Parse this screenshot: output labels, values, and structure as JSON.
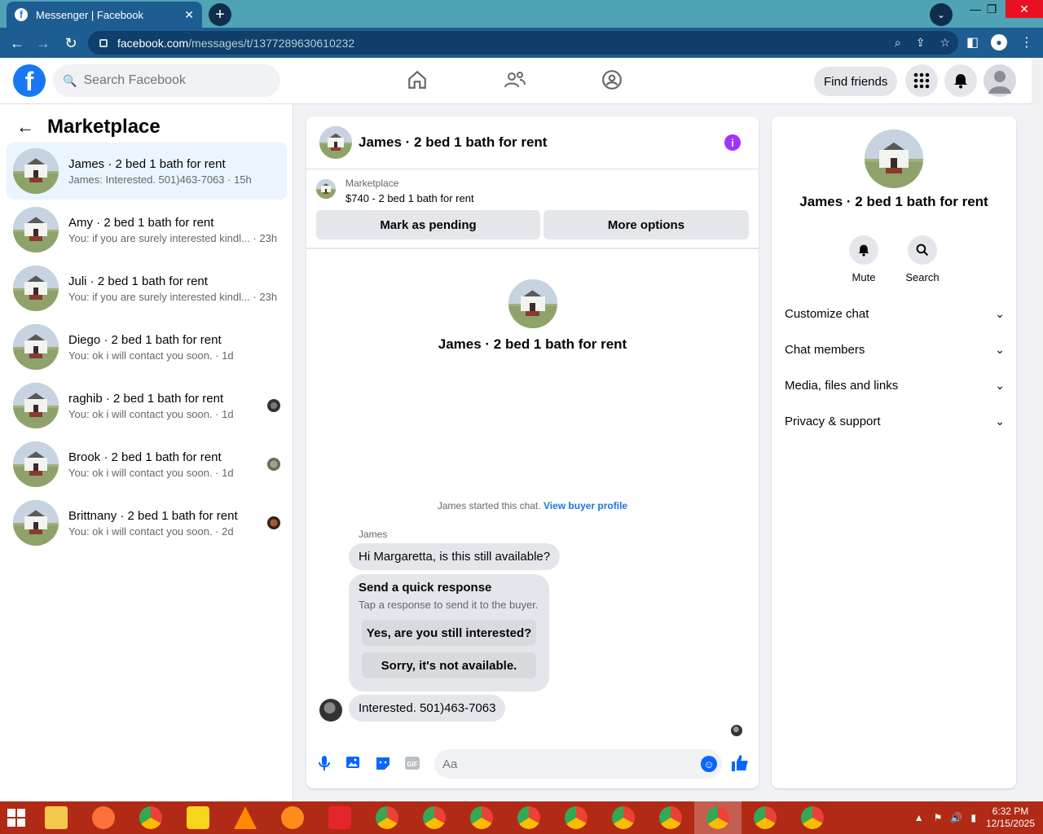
{
  "browser": {
    "tab_title": "Messenger | Facebook",
    "url_host": "facebook.com",
    "url_path": "/messages/t/1377289630610232"
  },
  "fb": {
    "search_placeholder": "Search Facebook",
    "find_friends": "Find friends"
  },
  "left": {
    "title": "Marketplace",
    "conversations": [
      {
        "name": "James · 2 bed 1 bath for rent",
        "preview": "James: Interested. 501)463-7063 · 15h",
        "active": true
      },
      {
        "name": "Amy · 2 bed 1 bath for rent",
        "preview": "You: if you are surely interested kindl... · 23h"
      },
      {
        "name": "Juli · 2 bed 1 bath for rent",
        "preview": "You: if you are surely interested kindl... · 23h"
      },
      {
        "name": "Diego · 2 bed 1 bath for rent",
        "preview": "You: ok i will contact you soon. · 1d"
      },
      {
        "name": "raghib · 2 bed 1 bath for rent",
        "preview": "You: ok i will contact you soon. · 1d"
      },
      {
        "name": "Brook · 2 bed 1 bath for rent",
        "preview": "You: ok i will contact you soon. · 1d"
      },
      {
        "name": "Brittnany · 2 bed 1 bath for rent",
        "preview": "You: ok i will contact you soon. · 2d"
      }
    ]
  },
  "chat": {
    "title": "James · 2 bed 1 bath for rent",
    "listing_source": "Marketplace",
    "listing_price": "$740 - 2 bed 1 bath for rent",
    "mark_pending": "Mark as pending",
    "more_options": "More options",
    "intro_name": "James · 2 bed 1 bath for rent",
    "started_text": "James started this chat.",
    "view_buyer": "View buyer profile",
    "sender_name": "James",
    "msg1": "Hi Margaretta, is this still available?",
    "quick_title": "Send a quick response",
    "quick_sub": "Tap a response to send it to the buyer.",
    "quick_opt1": "Yes, are you still interested?",
    "quick_opt2": "Sorry, it's not available.",
    "msg2": "Interested. 501)463-7063",
    "composer_placeholder": "Aa"
  },
  "right": {
    "name": "James · 2 bed 1 bath for rent",
    "mute": "Mute",
    "search": "Search",
    "items": [
      "Customize chat",
      "Chat members",
      "Media, files and links",
      "Privacy & support"
    ]
  },
  "taskbar": {
    "time": "6:32 PM",
    "date": "12/15/2025"
  },
  "colors": {
    "fb_blue": "#1877f2",
    "link_blue": "#1b74e4",
    "info_purple": "#a033ff",
    "taskbar_red": "#b12a16",
    "browser_teal": "#4fa3b4"
  }
}
